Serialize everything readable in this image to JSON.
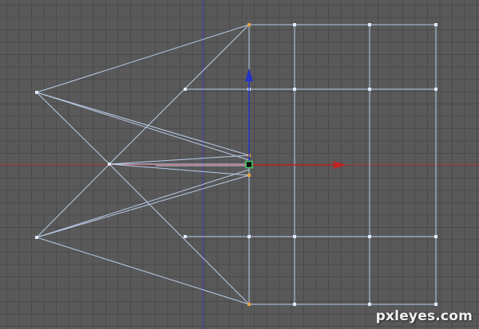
{
  "viewport": {
    "background": "#595959",
    "grid_color": "#4a4a4a",
    "x_axis_color": "#b83a3a",
    "y_axis_color": "#3a3ab8",
    "wire_color": "#b8cce8",
    "vertex_color": "#dfe9f7",
    "selected_vertex_color": "#e8a040",
    "pivot_color": "#111111",
    "pivot_border_color": "#4fd06a"
  },
  "gizmo": {
    "x_arrow_color": "#c72020",
    "y_arrow_color": "#2432c8"
  },
  "watermark": {
    "text": "pxleyes.com"
  }
}
